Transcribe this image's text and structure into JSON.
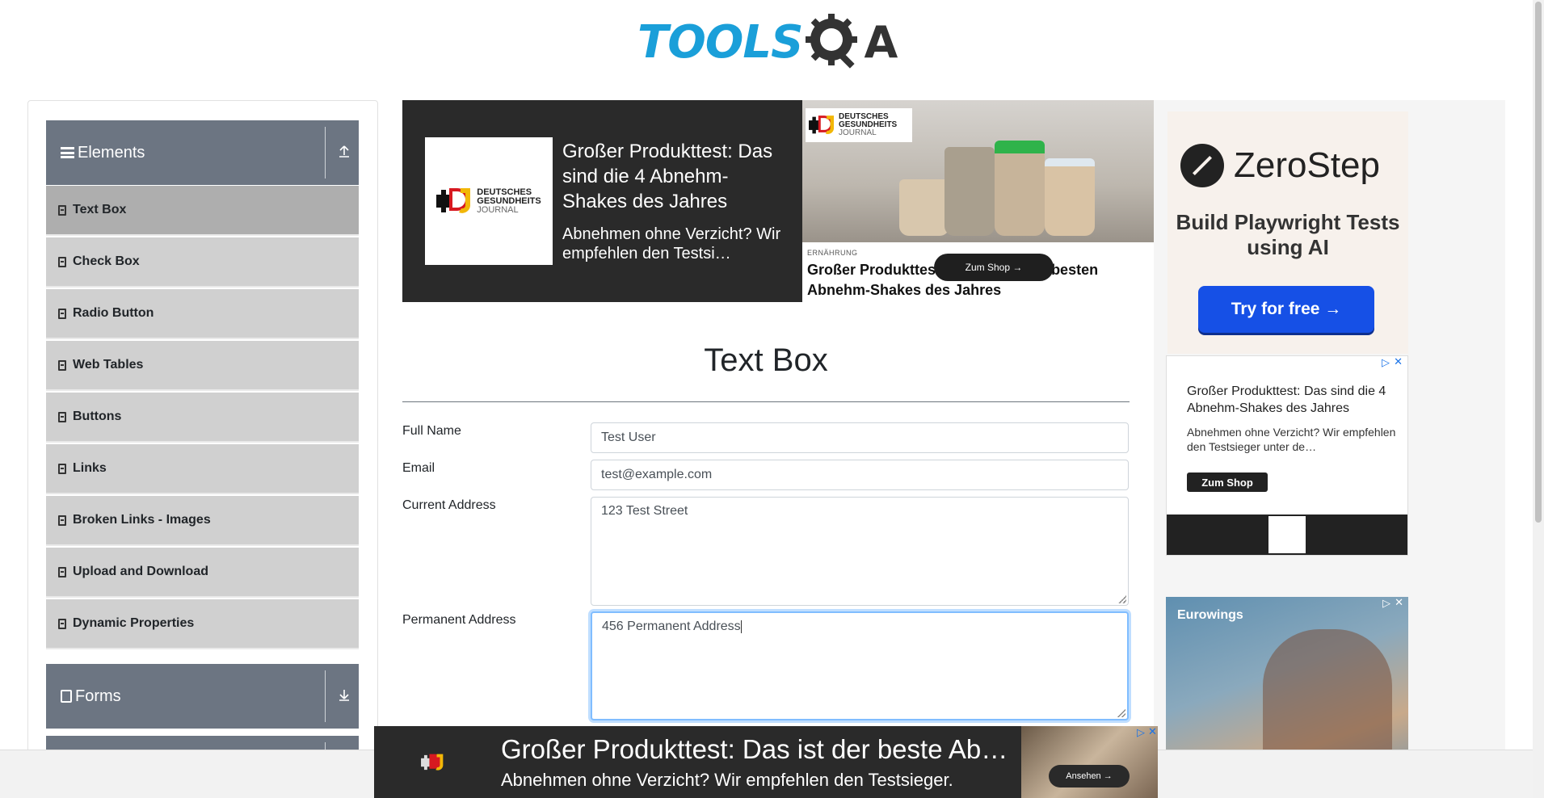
{
  "logo": {
    "tools": "TOOLS",
    "a": "A"
  },
  "sidebar": {
    "elements_label": "Elements",
    "forms_label": "Forms",
    "items": [
      {
        "label": "Text Box",
        "active": true
      },
      {
        "label": "Check Box"
      },
      {
        "label": "Radio Button"
      },
      {
        "label": "Web Tables"
      },
      {
        "label": "Buttons"
      },
      {
        "label": "Links"
      },
      {
        "label": "Broken Links - Images"
      },
      {
        "label": "Upload and Download"
      },
      {
        "label": "Dynamic Properties"
      }
    ]
  },
  "ad_top": {
    "brand_line1": "DEUTSCHES",
    "brand_line2": "GESUNDHEITS",
    "brand_line3": "JOURNAL",
    "title": "Großer Produkttest: Das sind die 4 Abnehm-Shakes des Jahres",
    "desc": "Abnehmen ohne Verzicht? Wir empfehlen den Testsi…",
    "category": "ERNÄHRUNG",
    "caption": "Großer Produkttest: Das sind die 4 besten Abnehm-Shakes des Jahres",
    "cta": "Zum Shop →"
  },
  "main": {
    "title": "Text Box",
    "full_name_label": "Full Name",
    "full_name_value": "Test User",
    "email_label": "Email",
    "email_value": "test@example.com",
    "current_address_label": "Current Address",
    "current_address_value": "123 Test Street",
    "permanent_address_label": "Permanent Address",
    "permanent_address_value": "456 Permanent Address"
  },
  "ad_right": {
    "zerostep_name": "ZeroStep",
    "zerostep_tag": "Build Playwright Tests using AI",
    "zerostep_cta": "Try for free →",
    "small_title": "Großer Produkttest: Das sind die 4 Abnehm-Shakes des Jahres",
    "small_desc": "Abnehmen ohne Verzicht? Wir empfehlen den Testsieger unter de…",
    "small_cta": "Zum Shop",
    "eurowings": "Eurowings"
  },
  "ad_bottom": {
    "title": "Großer Produkttest: Das ist der beste Abn…",
    "desc": "Abnehmen ohne Verzicht? Wir empfehlen den Testsieger.",
    "cta": "Ansehen →"
  },
  "colors": {
    "brand_blue": "#1a9fd9",
    "group_header": "#6c7582",
    "menu_item": "#d0d0d0",
    "menu_item_active": "#aeaeae",
    "zerostep_button": "#1650e6"
  }
}
